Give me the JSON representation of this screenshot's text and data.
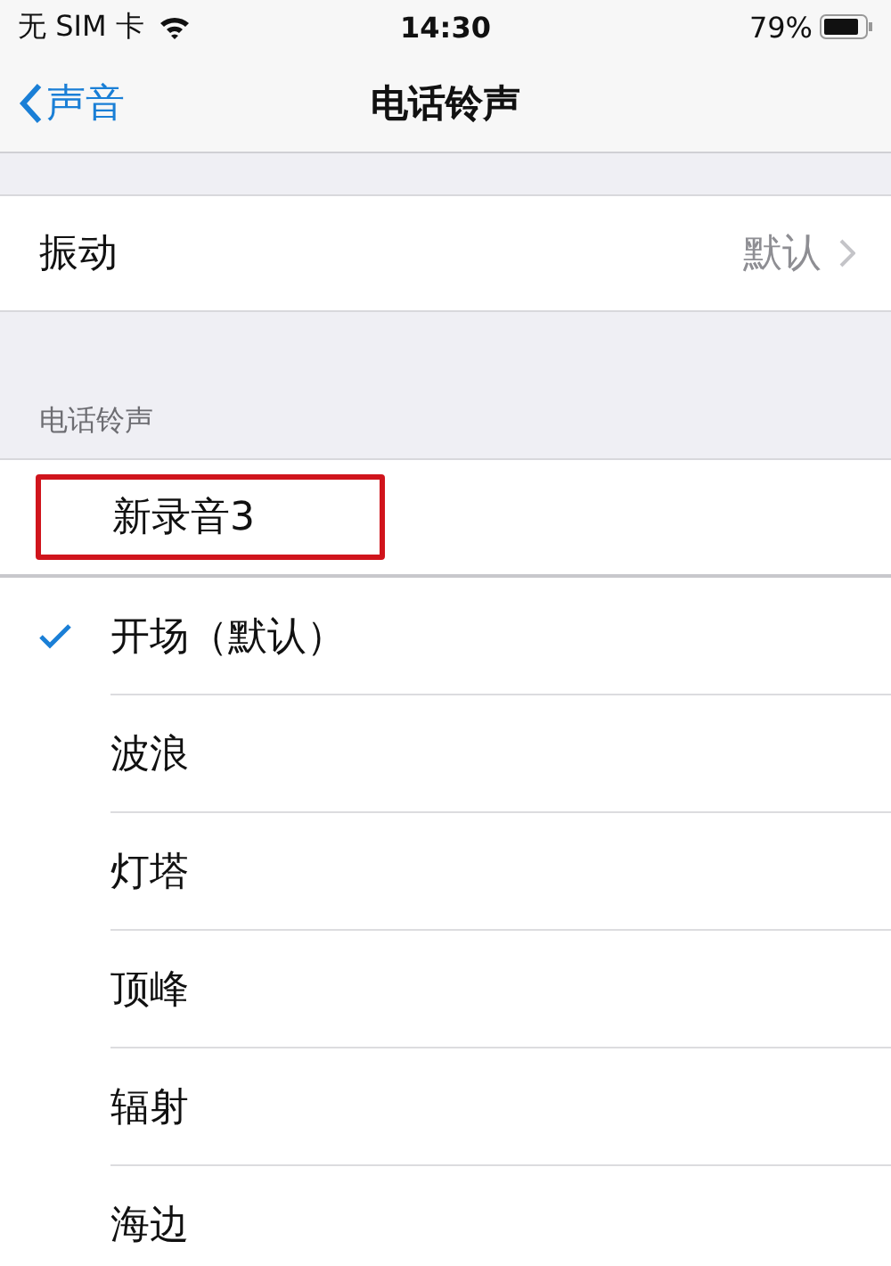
{
  "status_bar": {
    "carrier": "无 SIM 卡",
    "time": "14:30",
    "battery": "79%"
  },
  "nav": {
    "back": "声音",
    "title": "电话铃声"
  },
  "vibration": {
    "label": "振动",
    "value": "默认"
  },
  "section_header": "电话铃声",
  "custom_tones": [
    {
      "name": "新录音3",
      "highlighted": true
    }
  ],
  "tones": [
    {
      "name": "开场（默认）",
      "selected": true
    },
    {
      "name": "波浪",
      "selected": false
    },
    {
      "name": "灯塔",
      "selected": false
    },
    {
      "name": "顶峰",
      "selected": false
    },
    {
      "name": "辐射",
      "selected": false
    },
    {
      "name": "海边",
      "selected": false
    }
  ]
}
